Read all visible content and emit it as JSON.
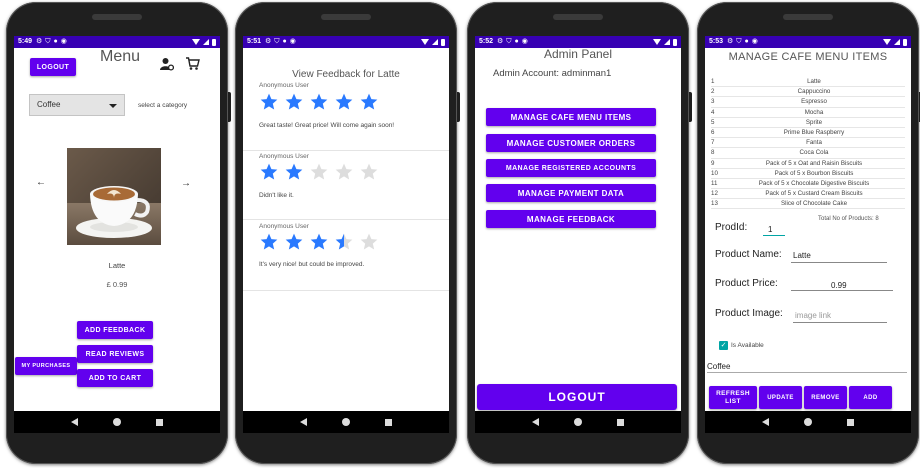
{
  "status": {
    "s1_time": "5:49",
    "s2_time": "5:51",
    "s3_time": "5:52",
    "s4_time": "5:53"
  },
  "menu": {
    "title": "Menu",
    "logout": "LOGOUT",
    "category_value": "Coffee",
    "category_hint": "select a category",
    "prev_arrow": "←",
    "next_arrow": "→",
    "product_name": "Latte",
    "product_price": "£ 0.99",
    "add_feedback": "ADD FEEDBACK",
    "read_reviews": "READ REVIEWS",
    "add_to_cart": "ADD TO CART",
    "my_purchases": "MY PURCHASES",
    "icons": [
      "user-settings-icon",
      "shopping-cart-icon"
    ]
  },
  "feedback": {
    "title": "View Feedback for Latte",
    "items": [
      {
        "user": "Anonymous User",
        "rating": 5,
        "comment": "Great taste! Great price! Will come again soon!"
      },
      {
        "user": "Anonymous User",
        "rating": 2,
        "comment": "Didn't like it."
      },
      {
        "user": "Anonymous User",
        "rating": 3.5,
        "comment": "It's very nice! but could be improved."
      }
    ],
    "star_color": "#2979ff",
    "star_empty_color": "#dddddd"
  },
  "admin": {
    "title": "Admin Panel",
    "account": "Admin Account: adminman1",
    "buttons": [
      "MANAGE CAFE MENU ITEMS",
      "MANAGE CUSTOMER ORDERS",
      "MANAGE REGISTERED ACCOUNTS",
      "MANAGE PAYMENT DATA",
      "MANAGE FEEDBACK"
    ],
    "logout": "LOGOUT"
  },
  "manage": {
    "title": "MANAGE CAFE MENU ITEMS",
    "rows": [
      {
        "id": "1",
        "name": "Latte"
      },
      {
        "id": "2",
        "name": "Cappuccino"
      },
      {
        "id": "3",
        "name": "Espresso"
      },
      {
        "id": "4",
        "name": "Mocha"
      },
      {
        "id": "5",
        "name": "Sprite"
      },
      {
        "id": "6",
        "name": "Prime Blue Raspberry"
      },
      {
        "id": "7",
        "name": "Fanta"
      },
      {
        "id": "8",
        "name": "Coca Cola"
      },
      {
        "id": "9",
        "name": "Pack of 5 x Oat and Raisin Biscuits"
      },
      {
        "id": "10",
        "name": "Pack of 5 x Bourbon Biscuits"
      },
      {
        "id": "11",
        "name": "Pack of 5 x Chocolate Digestive Biscuits"
      },
      {
        "id": "12",
        "name": "Pack of 5 x Custard Cream Biscuits"
      },
      {
        "id": "13",
        "name": "Slice of Chocolate Cake"
      }
    ],
    "total_label": "Total No of Products: 8",
    "prodid_label": "ProdId:",
    "prodid_value": "1",
    "name_label": "Product Name:",
    "name_value": "Latte",
    "price_label": "Product Price:",
    "price_value": "0.99",
    "image_label": "Product Image:",
    "image_placeholder": "image link",
    "available_label": "Is Available",
    "category_value": "Coffee",
    "refresh": "REFRESH LIST",
    "update": "UPDATE",
    "remove": "REMOVE",
    "add": "ADD"
  }
}
